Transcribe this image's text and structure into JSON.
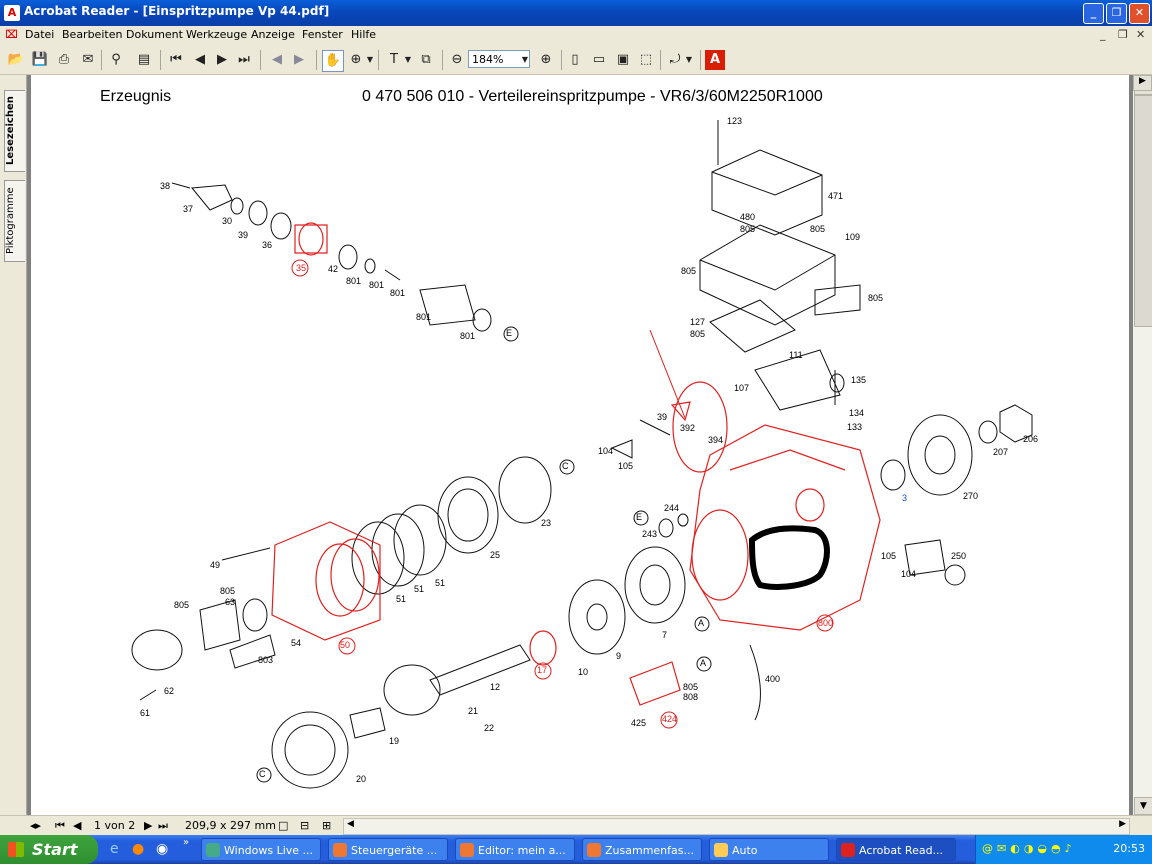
{
  "window": {
    "title": "Acrobat Reader - [Einspritzpumpe Vp 44.pdf]"
  },
  "menu": [
    "Datei",
    "Bearbeiten",
    "Dokument",
    "Werkzeuge",
    "Anzeige",
    "Fenster",
    "Hilfe"
  ],
  "toolbar": {
    "zoom": "184%"
  },
  "nav_tabs": [
    "Lesezeichen",
    "Piktogramme"
  ],
  "document": {
    "header_left": "Erzeugnis",
    "header_right": "0 470 506 010 - Verteilereinspritzpumpe - VR6/3/60M2250R1000",
    "part_labels": [
      "123",
      "471",
      "480",
      "805",
      "805",
      "109",
      "805",
      "805",
      "127",
      "805",
      "111",
      "107",
      "135",
      "134",
      "133",
      "206",
      "207",
      "270",
      "3",
      "38",
      "37",
      "30",
      "39",
      "36",
      "35",
      "42",
      "801",
      "801",
      "801",
      "801",
      "801",
      "E",
      "392",
      "394",
      "39",
      "104",
      "105",
      "C",
      "23",
      "25",
      "51",
      "51",
      "51",
      "E",
      "244",
      "243",
      "105",
      "104",
      "250",
      "49",
      "805",
      "63",
      "805",
      "54",
      "50",
      "62",
      "61",
      "803",
      "12",
      "17",
      "10",
      "9",
      "7",
      "A",
      "800",
      "A",
      "805",
      "808",
      "424",
      "425",
      "400",
      "21",
      "22",
      "19",
      "C",
      "20"
    ]
  },
  "status": {
    "page": "1 von 2",
    "size": "209,9 x 297 mm"
  },
  "taskbar": {
    "start": "Start",
    "tasks": [
      "Windows Live ...",
      "Steuergeräte ...",
      "Editor: mein a...",
      "Zusammenfas...",
      "Auto",
      "Acrobat Read..."
    ],
    "clock": "20:53"
  },
  "colors": {
    "red": "#e02020",
    "blue": "#1a4bd0"
  }
}
